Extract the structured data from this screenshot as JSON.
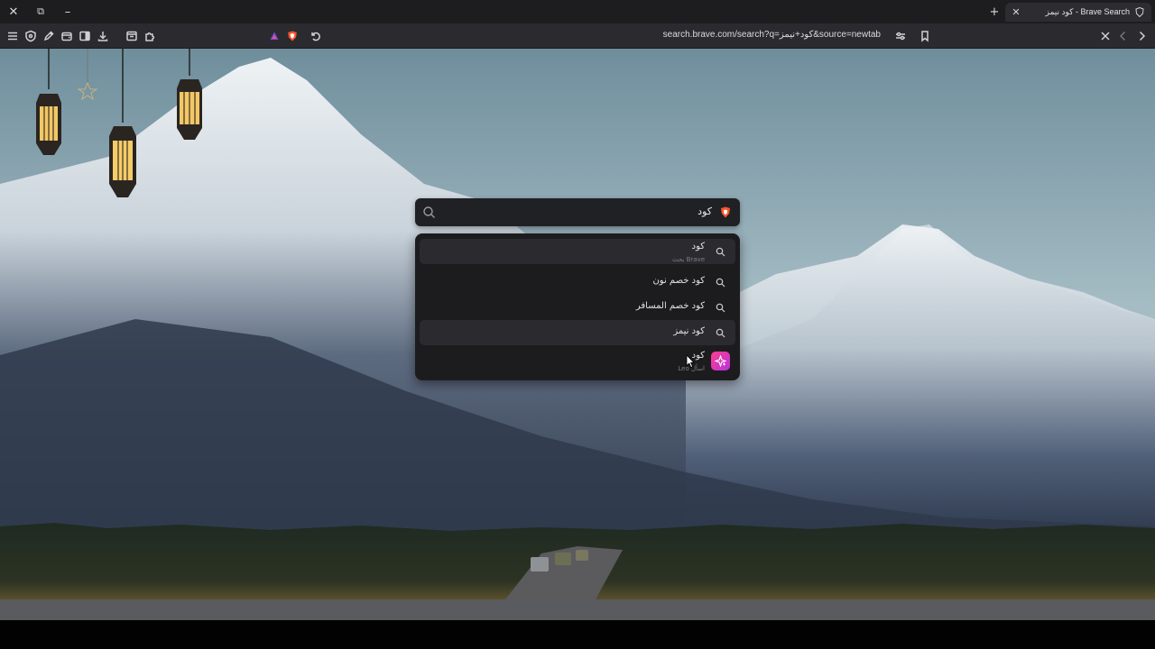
{
  "window": {
    "tab": {
      "title": "كود نيمز - Brave Search",
      "close": "✕"
    },
    "new_tab": "+",
    "controls": {
      "close": "✕",
      "restore": "⧉",
      "minimize": "–"
    }
  },
  "toolbar": {
    "url": "search.brave.com/search?q=كود+نيمز&source=newtab",
    "icons": [
      "menu-icon",
      "shield-icon",
      "pen-icon",
      "wallet-icon",
      "sidebar-icon",
      "download-icon",
      "screenshot-icon",
      "extensions-icon",
      "brave-rewards-icon",
      "brave-shields-icon",
      "reload-icon",
      "tune-icon",
      "bookmark-icon",
      "close-icon",
      "back-icon",
      "forward-icon"
    ]
  },
  "search": {
    "value": "كود"
  },
  "suggestions": [
    {
      "label": "كود",
      "sub": "Brave بحث",
      "icon": "search-icon",
      "highlighted": true
    },
    {
      "label": "كود خصم نون",
      "icon": "search-icon",
      "highlighted": false
    },
    {
      "label": "كود خصم المسافر",
      "icon": "search-icon",
      "highlighted": false
    },
    {
      "label": "كود نيمز",
      "icon": "search-icon",
      "highlighted": true
    },
    {
      "label": "كود",
      "sub": "اسأل Leo",
      "icon": "leo-icon",
      "highlighted": false
    }
  ],
  "colors": {
    "leo_gradient_start": "#ff3d8b",
    "leo_gradient_end": "#b932e0",
    "brave_orange": "#fb542b"
  }
}
